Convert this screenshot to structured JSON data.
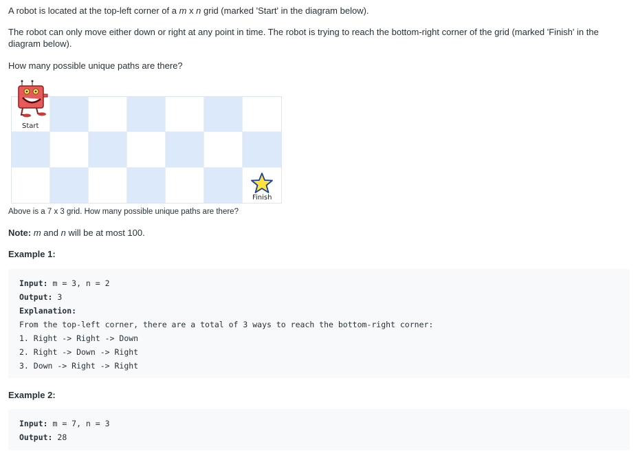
{
  "intro": {
    "line1_a": "A robot is located at the top-left corner of a ",
    "line1_m": "m",
    "line1_x": " x ",
    "line1_n": "n",
    "line1_b": " grid (marked 'Start' in the diagram below).",
    "line2": "The robot can only move either down or right at any point in time. The robot is trying to reach the bottom-right corner of the grid (marked 'Finish' in the diagram below).",
    "line3": "How many possible unique paths are there?"
  },
  "grid": {
    "cols": 7,
    "rows": 3,
    "start_label": "Start",
    "finish_label": "Finish"
  },
  "caption": "Above is a 7 x 3 grid. How many possible unique paths are there?",
  "note": {
    "label": "Note:",
    "m": "m",
    "and": " and ",
    "n": "n",
    "rest": " will be at most 100."
  },
  "example1": {
    "title": "Example 1:",
    "input_label": "Input:",
    "input_value": " m = 3, n = 2",
    "output_label": "Output:",
    "output_value": " 3",
    "explanation_label": "Explanation:",
    "lines": [
      "From the top-left corner, there are a total of 3 ways to reach the bottom-right corner:",
      "1. Right -> Right -> Down",
      "2. Right -> Down -> Right",
      "3. Down -> Right -> Right"
    ]
  },
  "example2": {
    "title": "Example 2:",
    "input_label": "Input:",
    "input_value": " m = 7, n = 3",
    "output_label": "Output:",
    "output_value": " 28"
  },
  "colors": {
    "cell_blue": "#dbe9fb",
    "code_bg": "#f7f9fa",
    "text": "#263238"
  }
}
